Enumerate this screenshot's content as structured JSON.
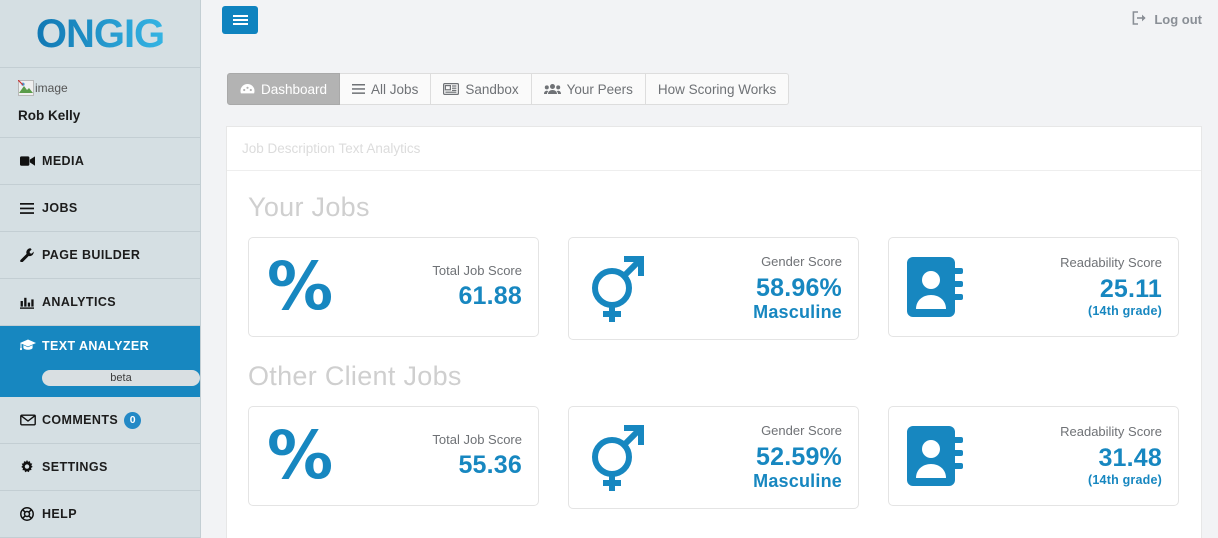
{
  "brand": {
    "logo_text": "ONGIG",
    "accent_color": "#1787c0",
    "sidebar_bg": "#d5dfe3"
  },
  "sidebar": {
    "user": {
      "avatar_alt": "image",
      "name": "Rob Kelly"
    },
    "items": [
      {
        "label": "MEDIA",
        "icon": "video-camera-icon",
        "active": false
      },
      {
        "label": "JOBS",
        "icon": "list-icon",
        "active": false
      },
      {
        "label": "PAGE BUILDER",
        "icon": "wrench-icon",
        "active": false
      },
      {
        "label": "ANALYTICS",
        "icon": "bar-chart-icon",
        "active": false
      },
      {
        "label": "TEXT ANALYZER",
        "icon": "graduation-cap-icon",
        "active": true,
        "badge": "beta"
      },
      {
        "label": "COMMENTS",
        "icon": "envelope-icon",
        "active": false,
        "count": "0"
      },
      {
        "label": "SETTINGS",
        "icon": "gear-icon",
        "active": false
      },
      {
        "label": "HELP",
        "icon": "lifebuoy-icon",
        "active": false
      }
    ]
  },
  "topbar": {
    "menu_toggle_icon": "hamburger-icon",
    "logout_label": "Log out",
    "logout_icon": "sign-out-icon"
  },
  "tabs": [
    {
      "label": "Dashboard",
      "icon": "dashboard-icon",
      "active": true
    },
    {
      "label": "All Jobs",
      "icon": "list-icon",
      "active": false
    },
    {
      "label": "Sandbox",
      "icon": "newspaper-icon",
      "active": false
    },
    {
      "label": "Your Peers",
      "icon": "users-icon",
      "active": false
    },
    {
      "label": "How Scoring Works",
      "icon": "",
      "active": false
    }
  ],
  "panel": {
    "breadcrumb": "Job Description Text Analytics",
    "sections": [
      {
        "title": "Your Jobs",
        "cards": [
          {
            "icon": "percent-icon",
            "label": "Total Job Score",
            "value": "61.88",
            "sub": ""
          },
          {
            "icon": "gender-icon",
            "label": "Gender Score",
            "value": "58.96%",
            "sub": "Masculine"
          },
          {
            "icon": "address-book-icon",
            "label": "Readability Score",
            "value": "25.11",
            "sub": "(14th grade)"
          }
        ]
      },
      {
        "title": "Other Client Jobs",
        "cards": [
          {
            "icon": "percent-icon",
            "label": "Total Job Score",
            "value": "55.36",
            "sub": ""
          },
          {
            "icon": "gender-icon",
            "label": "Gender Score",
            "value": "52.59%",
            "sub": "Masculine"
          },
          {
            "icon": "address-book-icon",
            "label": "Readability Score",
            "value": "31.48",
            "sub": "(14th grade)"
          }
        ]
      }
    ]
  }
}
